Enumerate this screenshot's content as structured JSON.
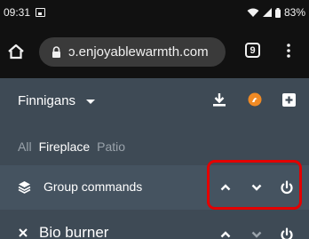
{
  "status_bar": {
    "time": "09:31",
    "battery": "83%"
  },
  "browser": {
    "url": "ɔ.enjoyablewarmth.com",
    "tab_count": "9"
  },
  "header": {
    "site_name": "Finnigans"
  },
  "filters": [
    {
      "label": "All"
    },
    {
      "label": "Fireplace"
    },
    {
      "label": "Patio"
    }
  ],
  "group": {
    "label": "Group commands"
  },
  "device": {
    "name": "Bio burner"
  },
  "colors": {
    "highlight": "#e30000",
    "logo_orange": "#f08a24",
    "background": "#3e4a55"
  }
}
